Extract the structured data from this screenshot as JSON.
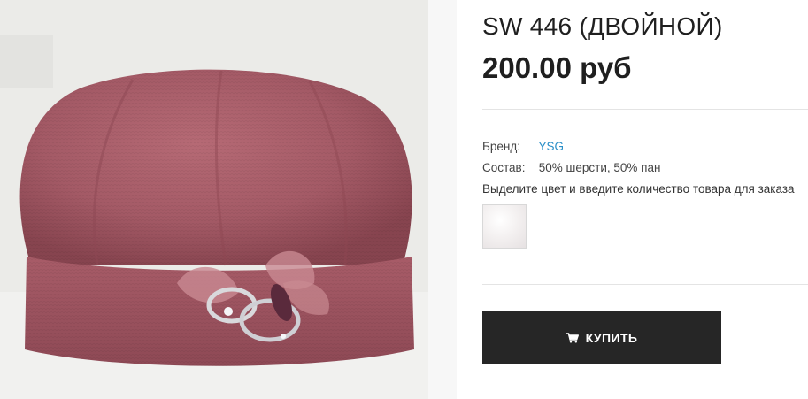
{
  "product": {
    "title": "SW 446 (ДВОЙНОЙ)",
    "price": "200.00 руб",
    "image_alt_icon": "product-photo-beret"
  },
  "details": {
    "brand_label": "Бренд:",
    "brand_value": "YSG",
    "composition_label": "Состав:",
    "composition_value": "50% шерсти, 50% пан"
  },
  "variant": {
    "hint": "Выделите цвет и введите количество товара для заказа",
    "swatches": [
      {
        "color": "#f2eeee"
      }
    ]
  },
  "actions": {
    "buy_label": "КУПИТЬ",
    "buy_icon": "shopping-cart-icon"
  },
  "colors": {
    "accent_link": "#2a8fc8",
    "button_bg": "#262626",
    "beret": "#a45a66"
  }
}
